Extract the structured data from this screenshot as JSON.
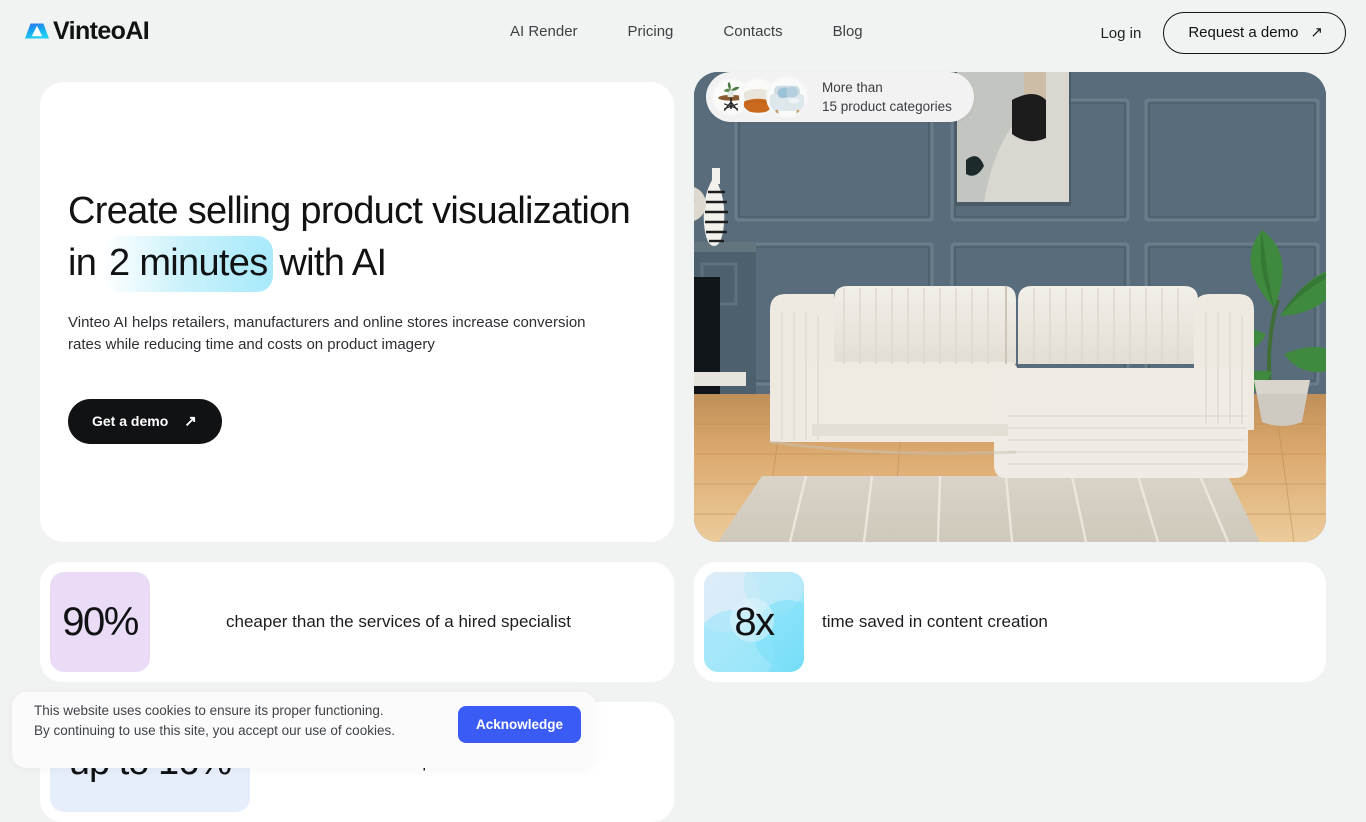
{
  "brand": {
    "name": "VinteoAI",
    "logo_icon": "vinteo-mountain-logo-icon"
  },
  "nav": {
    "items": [
      {
        "label": "AI Render"
      },
      {
        "label": "Pricing"
      },
      {
        "label": "Contacts"
      },
      {
        "label": "Blog"
      }
    ],
    "login_label": "Log in",
    "demo_label": "Request a demo",
    "demo_arrow": "↗"
  },
  "hero": {
    "headline_part1": "Create selling product visualization in ",
    "headline_highlight": "2 minutes",
    "headline_part2": " with AI",
    "subtext": "Vinteo AI helps retailers, manufacturers and online stores increase conversion rates while reducing time and costs on product imagery",
    "cta_label": "Get a demo",
    "cta_arrow": "↗",
    "image_alt": "living-room-with-cream-sectional-sofa",
    "badge": {
      "line1": "More than",
      "line2": "15 product categories",
      "thumb1": "side-table-with-plant-thumbnail",
      "thumb2": "stacked-pillows-thumbnail",
      "thumb3": "blue-armchair-thumbnail"
    }
  },
  "stats": [
    {
      "value": "90%",
      "description": "cheaper than the services of a hired specialist",
      "badge_color": "#eadcf7"
    },
    {
      "value": "8x",
      "description": "time saved in content creation",
      "badge_color": "#a9ebfb"
    },
    {
      "value": "up to 16%",
      "description": "boost online purchase conversion",
      "badge_color": "#e6edfb"
    }
  ],
  "cookie": {
    "line1": "This website uses cookies to ensure its proper functioning.",
    "line2": "By continuing to use this site, you accept our use of cookies.",
    "button_label": "Acknowledge",
    "button_color": "#3b5bf5"
  },
  "colors": {
    "page_background": "#f1f2f2",
    "card_background": "#ffffff",
    "text_primary": "#111214",
    "accent_cyan": "#a7eafb",
    "accent_blue": "#3b5bf5"
  }
}
